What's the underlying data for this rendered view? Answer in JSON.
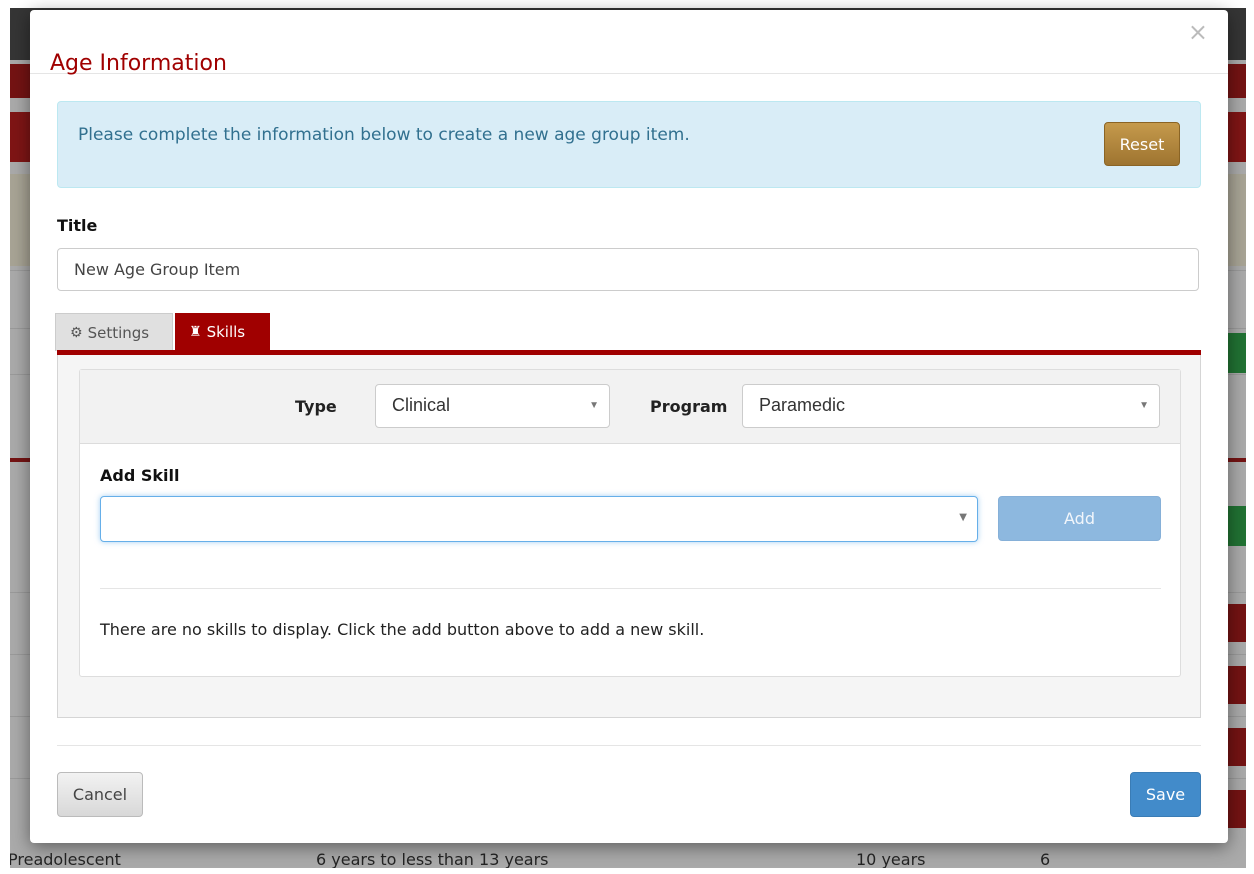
{
  "modal": {
    "title": "Age Information",
    "close_icon": "×",
    "info_message": "Please complete the information below to create a new age group item.",
    "reset_label": "Reset",
    "title_label": "Title",
    "title_value": "New Age Group Item",
    "tabs": [
      {
        "label": "Settings",
        "icon": "gears-icon",
        "glyph": "⚙",
        "active": false
      },
      {
        "label": "Skills",
        "icon": "rook-icon",
        "glyph": "♜",
        "active": true
      }
    ],
    "filters": {
      "type_label": "Type",
      "type_value": "Clinical",
      "program_label": "Program",
      "program_value": "Paramedic"
    },
    "add_skill_label": "Add Skill",
    "add_skill_value": "",
    "add_button_label": "Add",
    "empty_message": "There are no skills to display. Click the add button above to add a new skill.",
    "cancel_label": "Cancel",
    "save_label": "Save"
  },
  "background": {
    "row_text": [
      "Preadolescent",
      "6 years to less than 13 years",
      "10 years",
      "6"
    ]
  },
  "colors": {
    "title": "#a00000",
    "tab_active": "#a00000",
    "info_bg": "#d9edf7",
    "info_text": "#31708f",
    "reset": "#b08540",
    "save": "#428bca",
    "add_disabled": "#8db8df"
  }
}
